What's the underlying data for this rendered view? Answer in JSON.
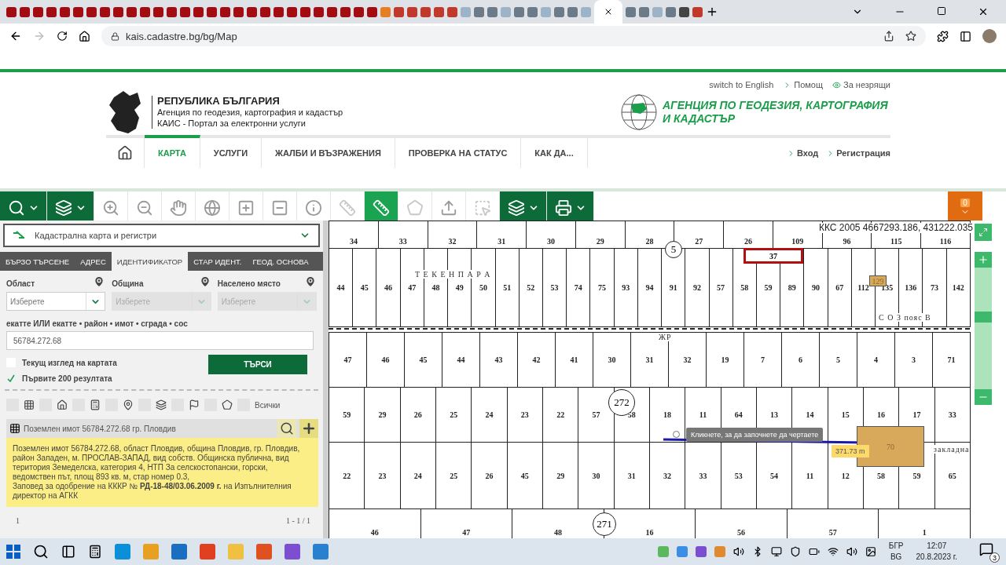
{
  "browser": {
    "address": "kais.cadastre.bg/bg/Map"
  },
  "header": {
    "top_links": [
      "switch to English",
      "Помощ",
      "За незрящи"
    ],
    "emblem_title": "РЕПУБЛИКА БЪЛГАРИЯ",
    "emblem_lines": [
      "Агенция по геодезия, картография и кадастър",
      "КАИС - Портал за електронни услуги"
    ],
    "agency_logo_text": "АГЕНЦИЯ ПО ГЕОДЕЗИЯ, КАРТОГРАФИЯ И КАДАСТЪР",
    "nav": [
      {
        "label": "КАРТА",
        "selected": true
      },
      {
        "label": "УСЛУГИ",
        "selected": false
      },
      {
        "label": "ЖАЛБИ И ВЪЗРАЖЕНИЯ",
        "selected": false
      },
      {
        "label": "ПРОВЕРКА НА СТАТУС",
        "selected": false
      },
      {
        "label": "КАК ДА...",
        "selected": false
      }
    ],
    "account_links": [
      "Вход",
      "Регистрация"
    ]
  },
  "toolbar": {
    "tools": [
      {
        "kind": "dropdown",
        "selected": false,
        "disabled": false
      },
      {
        "kind": "dropdown",
        "selected": false,
        "disabled": false
      },
      {
        "kind": "tool",
        "selected": false,
        "disabled": false
      },
      {
        "kind": "tool",
        "selected": false,
        "disabled": false
      },
      {
        "kind": "tool",
        "selected": false,
        "disabled": false
      },
      {
        "kind": "tool",
        "selected": false,
        "disabled": false
      },
      {
        "kind": "tool",
        "selected": false,
        "disabled": false
      },
      {
        "kind": "tool",
        "selected": false,
        "disabled": false
      },
      {
        "kind": "tool",
        "selected": false,
        "disabled": false
      },
      {
        "kind": "tool",
        "selected": false,
        "disabled": true
      },
      {
        "kind": "tool",
        "selected": true,
        "disabled": false
      },
      {
        "kind": "tool",
        "selected": false,
        "disabled": true
      },
      {
        "kind": "tool",
        "selected": false,
        "disabled": false
      },
      {
        "kind": "tool",
        "selected": false,
        "disabled": true
      },
      {
        "kind": "dropdown",
        "selected": false,
        "disabled": false
      },
      {
        "kind": "dropdown",
        "selected": false,
        "disabled": false
      }
    ],
    "counter": "0"
  },
  "panel": {
    "layer": "Кадастрална карта и регистри",
    "tabs": [
      {
        "label": "БЪРЗО ТЪРСЕНЕ",
        "selected": false
      },
      {
        "label": "АДРЕС",
        "selected": false
      },
      {
        "label": "ИДЕНТИФИКАТОР",
        "selected": true
      },
      {
        "label": "СТАР ИДЕНТ.",
        "selected": false
      },
      {
        "label": "ГЕОД. ОСНОВА",
        "selected": false
      }
    ],
    "fields": [
      {
        "label": "Област",
        "placeholder": "Изберете",
        "disabled": false
      },
      {
        "label": "Община",
        "placeholder": "Изберете",
        "disabled": true
      },
      {
        "label": "Населено място",
        "placeholder": "Изберете",
        "disabled": true
      }
    ],
    "query_label": "екатте ИЛИ екатте • район • имот • сграда • сос",
    "query_value": "56784.272.68",
    "options": [
      {
        "label": "Текущ изглед на картата",
        "checked": false
      },
      {
        "label": "Първите 200 резултата",
        "checked": true
      }
    ],
    "search_button": "ТЪРСИ",
    "filters": [
      {
        "checked": false
      },
      {
        "checked": false
      },
      {
        "checked": false
      },
      {
        "checked": false
      },
      {
        "checked": false
      },
      {
        "checked": false
      },
      {
        "checked": false
      },
      {
        "checked": false
      }
    ],
    "filter_all": "Всички",
    "result_title": "Поземлен имот 56784.272.68 гр. Пловдив",
    "result_text": "Поземлен имот 56784.272.68, област Пловдив, община Пловдив, гр. Пловдив, район Западен, м. ПРОСЛАВ-ЗАПАД, вид собств. Общинска публична, вид територия Земеделска, категория 4, НТП За селскостопански, горски, ведомствен път, площ 893 кв. м, стар номер 0.3,\nЗаповед за одобрение на КККР № **РД-18-48/03.06.2009 г.** на Изпълнителния директор на АГКК",
    "page": "1",
    "range": "1 - 1 / 1"
  },
  "map": {
    "coordinates": "ККС 2005 4667293.186, 431222.035",
    "bands": [
      [
        "34",
        "33",
        "32",
        "31",
        "30",
        "29",
        "28",
        "27",
        "26",
        "109",
        "96",
        "115",
        "116"
      ],
      [
        "44",
        "45",
        "46",
        "47",
        "48",
        "49",
        "50",
        "51",
        "52",
        "53",
        "74",
        "75",
        "93",
        "94",
        "91",
        "92",
        "57",
        "58",
        "59",
        "89",
        "90",
        "67",
        "112",
        "135",
        "136",
        "73",
        "142"
      ],
      [
        "47",
        "46",
        "45",
        "44",
        "43",
        "42",
        "41",
        "30",
        "31",
        "32",
        "19",
        "7",
        "6",
        "5",
        "4",
        "3",
        "71"
      ],
      [
        "59",
        "29",
        "26",
        "25",
        "24",
        "23",
        "22",
        "57",
        "58",
        "18",
        "11",
        "64",
        "13",
        "14",
        "15",
        "16",
        "17",
        "33"
      ],
      [
        "22",
        "23",
        "24",
        "25",
        "26",
        "45",
        "29",
        "30",
        "31",
        "32",
        "33",
        "53",
        "54",
        "11",
        "12",
        "58",
        "59",
        "65"
      ],
      [
        "46",
        "47",
        "48",
        "16",
        "56",
        "57",
        "1"
      ]
    ],
    "selected_parcel": "37",
    "buildings": [
      "129",
      "70"
    ],
    "circles": [
      "5",
      "272",
      "271"
    ],
    "place_labels": [
      "Т Е К Е Н  П А Р А",
      "С О З пояс В",
      "ЖР",
      "закладна"
    ],
    "zoom": {
      "level": 0.6
    },
    "hint": "Кликнете, за да започнете да чертаете",
    "measure": "371.73 m"
  },
  "taskbar": {
    "language": "БГР",
    "layout": "BG",
    "time": "12:07",
    "date": "20.8.2023 г.",
    "notifications": "3"
  }
}
